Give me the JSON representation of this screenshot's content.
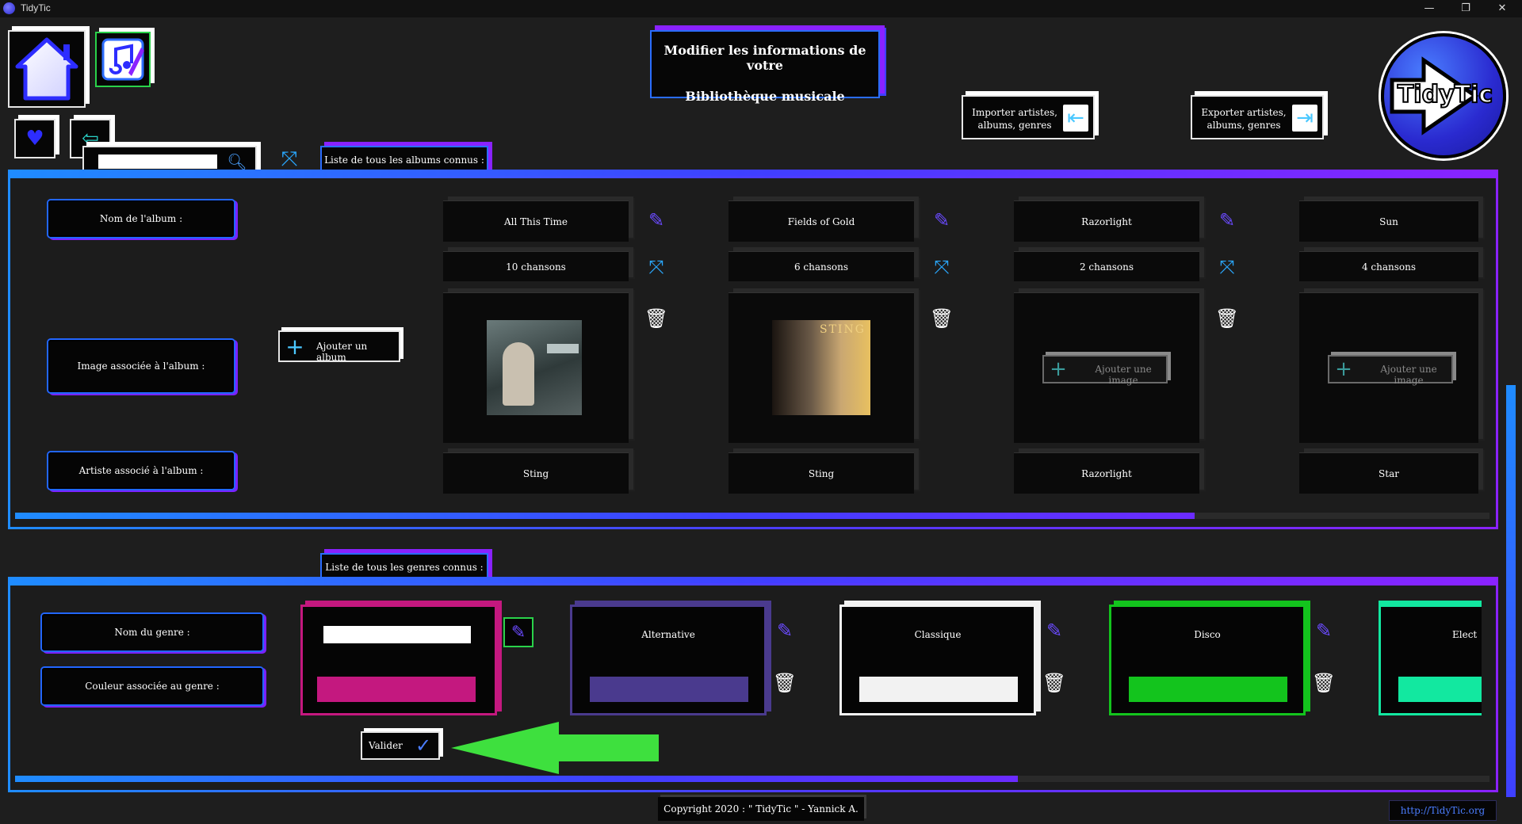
{
  "window": {
    "title": "TidyTic",
    "minimize": "—",
    "restore": "❐",
    "close": "✕"
  },
  "header": {
    "title_line1": "Modifier les informations de votre",
    "title_line2": "Bibliothèque musicale",
    "import_label": "Importer artistes, albums, genres",
    "export_label": "Exporter artistes, albums, genres",
    "logo_text": "TidyTic"
  },
  "search": {
    "placeholder": ""
  },
  "albums_section": {
    "tab_label": "Liste de tous les albums connus :",
    "row_labels": {
      "name": "Nom de l'album :",
      "image": "Image associée à l'album :",
      "artist": "Artiste associé à l'album :"
    },
    "add_album_label": "Ajouter un album",
    "add_image_label": "Ajouter une image",
    "albums": [
      {
        "name": "All This Time",
        "songs": "10 chansons",
        "artist": "Sting",
        "cover": "sting-all-this-time"
      },
      {
        "name": "Fields of Gold",
        "songs": "6 chansons",
        "artist": "Sting",
        "cover": "sting-fields-of-gold",
        "cover_text": "STING"
      },
      {
        "name": "Razorlight",
        "songs": "2 chansons",
        "artist": "Razorlight",
        "cover": ""
      },
      {
        "name": "Sun",
        "songs": "4 chansons",
        "artist": "Star",
        "cover": ""
      }
    ],
    "scroll_fraction": 0.8
  },
  "genres_section": {
    "tab_label": "Liste de tous les genres connus :",
    "row_labels": {
      "name": "Nom du genre :",
      "color": "Couleur associée au genre :"
    },
    "new_genre": {
      "name_value": "",
      "color": "#c4187f"
    },
    "validate_label": "Valider",
    "genres": [
      {
        "name": "Alternative",
        "color": "#4a3a8e",
        "frame": "#4a3a8e"
      },
      {
        "name": "Classique",
        "color": "#f2f2f2",
        "frame": "#f2f2f2"
      },
      {
        "name": "Disco",
        "color": "#13c41d",
        "frame": "#13c41d"
      },
      {
        "name": "Elect",
        "color": "#12e8a0",
        "frame": "#12e8a0"
      }
    ],
    "scroll_fraction": 0.68
  },
  "footer": {
    "copyright": "Copyright 2020 : \" TidyTic \" - Yannick A.",
    "link": "http://TidyTic.org"
  },
  "colors": {
    "accent_blue": "#2d2dff",
    "accent_purple": "#8a22ff",
    "accent_cyan": "#1f8cff",
    "arrow_green": "#3ee03e"
  }
}
